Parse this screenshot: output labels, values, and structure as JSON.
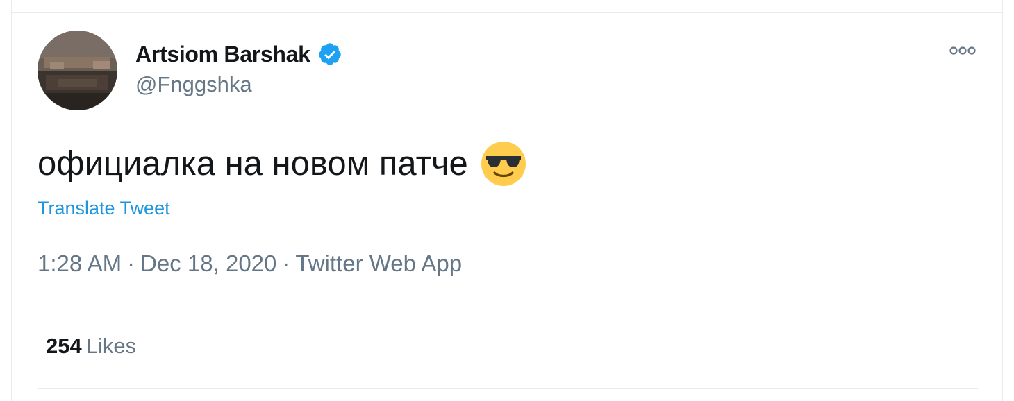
{
  "tweet": {
    "author": {
      "display_name": "Artsiom Barshak",
      "handle": "@Fnggshka",
      "verified": true
    },
    "text": "официалка на новом патче",
    "emoji": "smiling-face-with-sunglasses",
    "translate_label": "Translate Tweet",
    "time": "1:28 AM",
    "date": "Dec 18, 2020",
    "source": "Twitter Web App",
    "separator": "·",
    "likes_count": "254",
    "likes_label": "Likes"
  },
  "colors": {
    "text_primary": "#14171a",
    "text_secondary": "#657786",
    "link": "#1b95e0",
    "verified_badge": "#1da1f2",
    "border": "#e6ecf0"
  }
}
